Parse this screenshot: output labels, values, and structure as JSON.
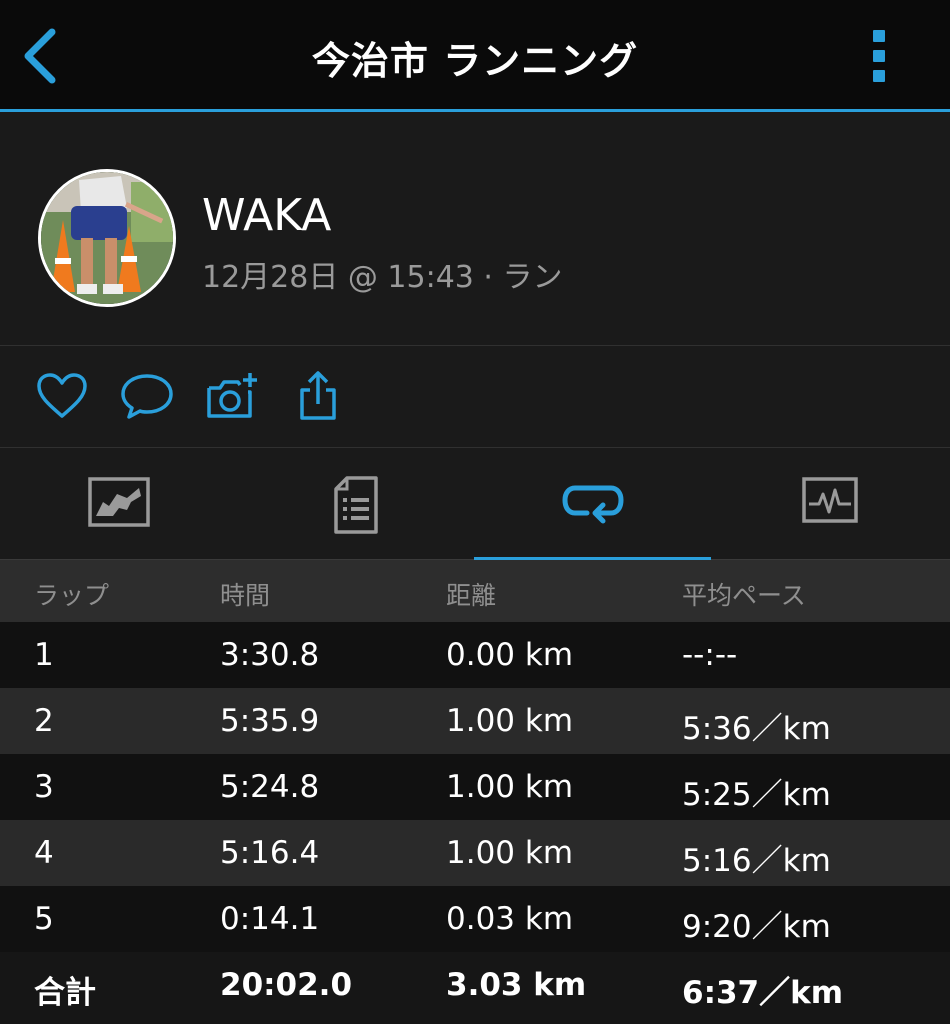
{
  "header": {
    "title": "今治市 ランニング",
    "back_icon": "chevron-left-icon",
    "more_icon": "more-vertical-icon"
  },
  "profile": {
    "name": "WAKA",
    "meta": "12月28日 @ 15:43 · ラン"
  },
  "actions": [
    "heart-icon",
    "comment-icon",
    "camera-add-icon",
    "share-icon"
  ],
  "tabs": [
    {
      "icon": "map-icon",
      "active": false
    },
    {
      "icon": "summary-list-icon",
      "active": false
    },
    {
      "icon": "laps-icon",
      "active": true
    },
    {
      "icon": "chart-icon",
      "active": false
    }
  ],
  "laps": {
    "headers": [
      "ラップ",
      "時間",
      "距離",
      "平均ペース"
    ],
    "rows": [
      [
        "1",
        "3:30.8",
        "0.00 km",
        "--:--"
      ],
      [
        "2",
        "5:35.9",
        "1.00 km",
        "5:36／km"
      ],
      [
        "3",
        "5:24.8",
        "1.00 km",
        "5:25／km"
      ],
      [
        "4",
        "5:16.4",
        "1.00 km",
        "5:16／km"
      ],
      [
        "5",
        "0:14.1",
        "0.03 km",
        "9:20／km"
      ]
    ],
    "total": [
      "合計",
      "20:02.0",
      "3.03 km",
      "6:37／km"
    ]
  },
  "colors": {
    "accent": "#2a9fdb",
    "background": "#161616",
    "header_bg": "#0a0a0a"
  }
}
